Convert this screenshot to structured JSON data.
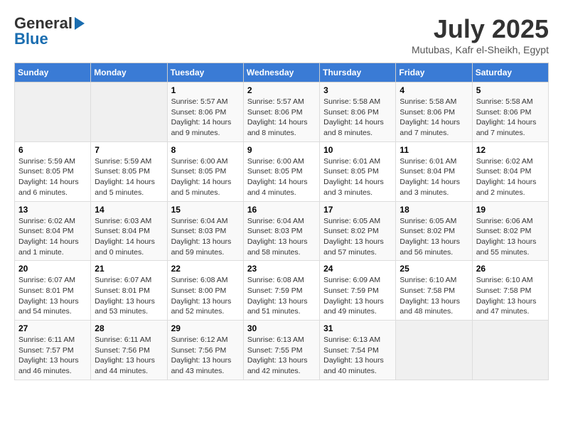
{
  "header": {
    "logo_line1": "General",
    "logo_line2": "Blue",
    "month": "July 2025",
    "location": "Mutubas, Kafr el-Sheikh, Egypt"
  },
  "days_of_week": [
    "Sunday",
    "Monday",
    "Tuesday",
    "Wednesday",
    "Thursday",
    "Friday",
    "Saturday"
  ],
  "weeks": [
    [
      {
        "num": "",
        "detail": ""
      },
      {
        "num": "",
        "detail": ""
      },
      {
        "num": "1",
        "detail": "Sunrise: 5:57 AM\nSunset: 8:06 PM\nDaylight: 14 hours and 9 minutes."
      },
      {
        "num": "2",
        "detail": "Sunrise: 5:57 AM\nSunset: 8:06 PM\nDaylight: 14 hours and 8 minutes."
      },
      {
        "num": "3",
        "detail": "Sunrise: 5:58 AM\nSunset: 8:06 PM\nDaylight: 14 hours and 8 minutes."
      },
      {
        "num": "4",
        "detail": "Sunrise: 5:58 AM\nSunset: 8:06 PM\nDaylight: 14 hours and 7 minutes."
      },
      {
        "num": "5",
        "detail": "Sunrise: 5:58 AM\nSunset: 8:06 PM\nDaylight: 14 hours and 7 minutes."
      }
    ],
    [
      {
        "num": "6",
        "detail": "Sunrise: 5:59 AM\nSunset: 8:05 PM\nDaylight: 14 hours and 6 minutes."
      },
      {
        "num": "7",
        "detail": "Sunrise: 5:59 AM\nSunset: 8:05 PM\nDaylight: 14 hours and 5 minutes."
      },
      {
        "num": "8",
        "detail": "Sunrise: 6:00 AM\nSunset: 8:05 PM\nDaylight: 14 hours and 5 minutes."
      },
      {
        "num": "9",
        "detail": "Sunrise: 6:00 AM\nSunset: 8:05 PM\nDaylight: 14 hours and 4 minutes."
      },
      {
        "num": "10",
        "detail": "Sunrise: 6:01 AM\nSunset: 8:05 PM\nDaylight: 14 hours and 3 minutes."
      },
      {
        "num": "11",
        "detail": "Sunrise: 6:01 AM\nSunset: 8:04 PM\nDaylight: 14 hours and 3 minutes."
      },
      {
        "num": "12",
        "detail": "Sunrise: 6:02 AM\nSunset: 8:04 PM\nDaylight: 14 hours and 2 minutes."
      }
    ],
    [
      {
        "num": "13",
        "detail": "Sunrise: 6:02 AM\nSunset: 8:04 PM\nDaylight: 14 hours and 1 minute."
      },
      {
        "num": "14",
        "detail": "Sunrise: 6:03 AM\nSunset: 8:04 PM\nDaylight: 14 hours and 0 minutes."
      },
      {
        "num": "15",
        "detail": "Sunrise: 6:04 AM\nSunset: 8:03 PM\nDaylight: 13 hours and 59 minutes."
      },
      {
        "num": "16",
        "detail": "Sunrise: 6:04 AM\nSunset: 8:03 PM\nDaylight: 13 hours and 58 minutes."
      },
      {
        "num": "17",
        "detail": "Sunrise: 6:05 AM\nSunset: 8:02 PM\nDaylight: 13 hours and 57 minutes."
      },
      {
        "num": "18",
        "detail": "Sunrise: 6:05 AM\nSunset: 8:02 PM\nDaylight: 13 hours and 56 minutes."
      },
      {
        "num": "19",
        "detail": "Sunrise: 6:06 AM\nSunset: 8:02 PM\nDaylight: 13 hours and 55 minutes."
      }
    ],
    [
      {
        "num": "20",
        "detail": "Sunrise: 6:07 AM\nSunset: 8:01 PM\nDaylight: 13 hours and 54 minutes."
      },
      {
        "num": "21",
        "detail": "Sunrise: 6:07 AM\nSunset: 8:01 PM\nDaylight: 13 hours and 53 minutes."
      },
      {
        "num": "22",
        "detail": "Sunrise: 6:08 AM\nSunset: 8:00 PM\nDaylight: 13 hours and 52 minutes."
      },
      {
        "num": "23",
        "detail": "Sunrise: 6:08 AM\nSunset: 7:59 PM\nDaylight: 13 hours and 51 minutes."
      },
      {
        "num": "24",
        "detail": "Sunrise: 6:09 AM\nSunset: 7:59 PM\nDaylight: 13 hours and 49 minutes."
      },
      {
        "num": "25",
        "detail": "Sunrise: 6:10 AM\nSunset: 7:58 PM\nDaylight: 13 hours and 48 minutes."
      },
      {
        "num": "26",
        "detail": "Sunrise: 6:10 AM\nSunset: 7:58 PM\nDaylight: 13 hours and 47 minutes."
      }
    ],
    [
      {
        "num": "27",
        "detail": "Sunrise: 6:11 AM\nSunset: 7:57 PM\nDaylight: 13 hours and 46 minutes."
      },
      {
        "num": "28",
        "detail": "Sunrise: 6:11 AM\nSunset: 7:56 PM\nDaylight: 13 hours and 44 minutes."
      },
      {
        "num": "29",
        "detail": "Sunrise: 6:12 AM\nSunset: 7:56 PM\nDaylight: 13 hours and 43 minutes."
      },
      {
        "num": "30",
        "detail": "Sunrise: 6:13 AM\nSunset: 7:55 PM\nDaylight: 13 hours and 42 minutes."
      },
      {
        "num": "31",
        "detail": "Sunrise: 6:13 AM\nSunset: 7:54 PM\nDaylight: 13 hours and 40 minutes."
      },
      {
        "num": "",
        "detail": ""
      },
      {
        "num": "",
        "detail": ""
      }
    ]
  ]
}
